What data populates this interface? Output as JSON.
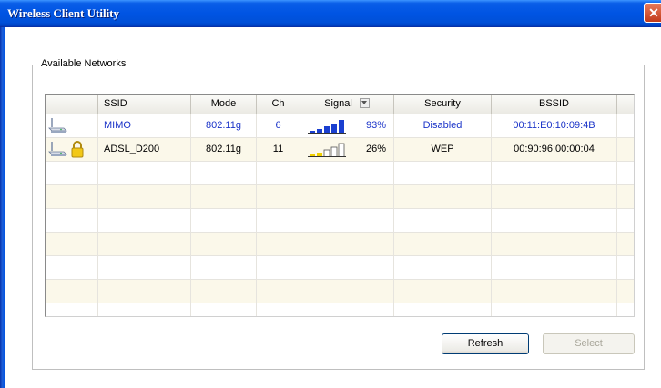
{
  "window": {
    "title": "Wireless Client Utility",
    "close_glyph": "✕"
  },
  "groupbox": {
    "label": "Available Networks"
  },
  "table": {
    "columns": [
      "",
      "SSID",
      "Mode",
      "Ch",
      "Signal",
      "Security",
      "BSSID"
    ],
    "rows": [
      {
        "icon": "wireless-network-icon",
        "locked": false,
        "ssid": "MIMO",
        "mode": "802.11g",
        "ch": "6",
        "signal_percent": "93%",
        "signal_bars_lit": 5,
        "security": "Disabled",
        "bssid": "00:11:E0:10:09:4B",
        "text_color": "#1a33c8"
      },
      {
        "icon": "wireless-network-icon",
        "locked": true,
        "ssid": "ADSL_D200",
        "mode": "802.11g",
        "ch": "11",
        "signal_percent": "26%",
        "signal_bars_lit": 2,
        "security": "WEP",
        "bssid": "00:90:96:00:00:04",
        "text_color": "#000000"
      }
    ],
    "colors": {
      "strong_bar": "#1a3fd0",
      "weak_bar": "#f0d000",
      "row_alt": "#fbf8ea"
    }
  },
  "buttons": {
    "refresh": "Refresh",
    "select": "Select"
  }
}
